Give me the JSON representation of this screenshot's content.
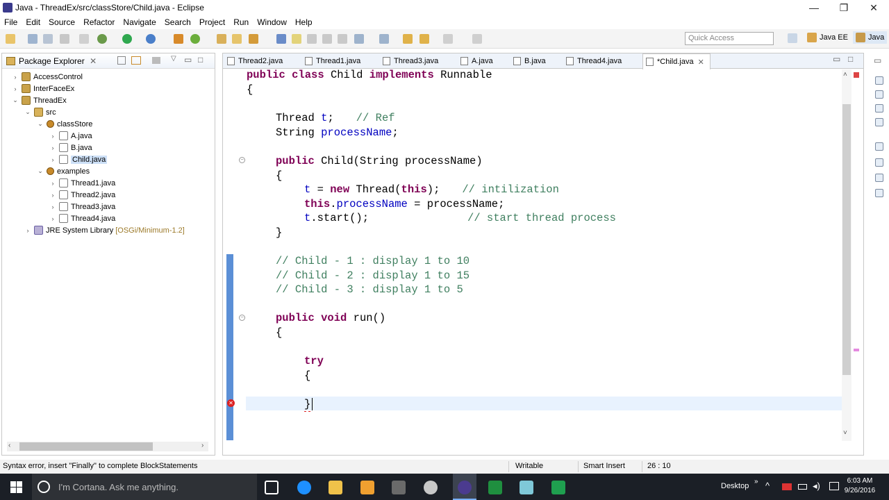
{
  "window": {
    "title": "Java - ThreadEx/src/classStore/Child.java - Eclipse",
    "min": "—",
    "max": "❐",
    "close": "✕"
  },
  "menu": [
    "File",
    "Edit",
    "Source",
    "Refactor",
    "Navigate",
    "Search",
    "Project",
    "Run",
    "Window",
    "Help"
  ],
  "quick_access": {
    "placeholder": "Quick Access"
  },
  "perspectives": [
    "Java EE",
    "Java"
  ],
  "package_explorer": {
    "title": "Package Explorer",
    "close": "✕",
    "tree": [
      {
        "label": "AccessControl",
        "kind": "proj",
        "depth": 0,
        "expanded": false
      },
      {
        "label": "InterFaceEx",
        "kind": "proj",
        "depth": 0,
        "expanded": false
      },
      {
        "label": "ThreadEx",
        "kind": "proj",
        "depth": 0,
        "expanded": true
      },
      {
        "label": "src",
        "kind": "src",
        "depth": 1,
        "expanded": true
      },
      {
        "label": "classStore",
        "kind": "pkg",
        "depth": 2,
        "expanded": true
      },
      {
        "label": "A.java",
        "kind": "java",
        "depth": 3,
        "expanded": false
      },
      {
        "label": "B.java",
        "kind": "java",
        "depth": 3,
        "expanded": false
      },
      {
        "label": "Child.java",
        "kind": "java",
        "depth": 3,
        "expanded": false,
        "selected": true
      },
      {
        "label": "examples",
        "kind": "pkg",
        "depth": 2,
        "expanded": true
      },
      {
        "label": "Thread1.java",
        "kind": "java",
        "depth": 3,
        "expanded": false
      },
      {
        "label": "Thread2.java",
        "kind": "java",
        "depth": 3,
        "expanded": false
      },
      {
        "label": "Thread3.java",
        "kind": "java",
        "depth": 3,
        "expanded": false
      },
      {
        "label": "Thread4.java",
        "kind": "java",
        "depth": 3,
        "expanded": false
      },
      {
        "label": "JRE System Library",
        "kind": "jre",
        "depth": 1,
        "expanded": false,
        "suffix": "[OSGi/Minimum-1.2]"
      }
    ]
  },
  "editor": {
    "tabs": [
      {
        "label": "Thread2.java"
      },
      {
        "label": "Thread1.java"
      },
      {
        "label": "Thread3.java"
      },
      {
        "label": "A.java"
      },
      {
        "label": "B.java"
      },
      {
        "label": "Thread4.java"
      },
      {
        "label": "*Child.java",
        "active": true,
        "close": "✕"
      }
    ],
    "code": {
      "l1_kw1": "public",
      "l1_kw2": "class",
      "l1_name": " Child ",
      "l1_kw3": "implements",
      "l1_rest": " Runnable",
      "l2": "{",
      "l3_type": "Thread ",
      "l3_fld": "t",
      "l3_semi": ";",
      "l3_cm": "// Ref",
      "l4_type": "String ",
      "l4_fld": "processName",
      "l4_semi": ";",
      "l5_kw": "public",
      "l5_rest": " Child(String processName)",
      "l6": "{",
      "l7_fld": "t",
      "l7_eq": " = ",
      "l7_kw": "new",
      "l7_mid": " Thread(",
      "l7_this": "this",
      "l7_end": ");",
      "l7_cm": "// intilization",
      "l8_this": "this",
      "l8_dot": ".",
      "l8_fld": "processName",
      "l8_rest": " = processName;",
      "l9_fld": "t",
      "l9_rest": ".start();",
      "l9_cm": "// start thread process",
      "l10": "}",
      "c1": "// Child - 1 : display 1 to 10",
      "c2": "// Child - 2 : display 1 to 15",
      "c3": "// Child - 3 : display 1 to 5",
      "r_kw1": "public",
      "r_kw2": "void",
      "r_rest": " run()",
      "r_open": "{",
      "t_kw": "try",
      "t_open": "{",
      "t_close": "}"
    }
  },
  "status": {
    "message": "Syntax error, insert \"Finally\" to complete BlockStatements",
    "mode": "Writable",
    "insert": "Smart Insert",
    "pos": "26 : 10"
  },
  "taskbar": {
    "search_placeholder": "I'm Cortana. Ask me anything.",
    "desktop": "Desktop",
    "time": "6:03 AM",
    "date": "9/26/2016"
  }
}
